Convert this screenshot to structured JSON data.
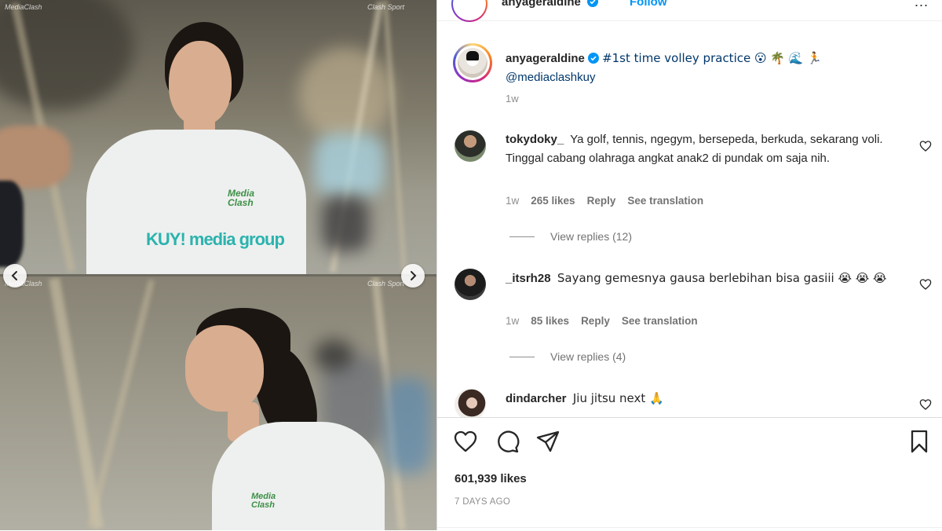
{
  "header": {
    "username": "anyageraldine",
    "follow_label": "Follow",
    "more_label": "..."
  },
  "caption": {
    "username": "anyageraldine",
    "text": "#1st time volley practice 😮 🌴 🌊 🏃",
    "mention": "@mediaclashkuy",
    "time": "1w"
  },
  "comments": [
    {
      "username": "tokydoky_",
      "text": "Ya golf, tennis, ngegym, bersepeda, berkuda, sekarang voli. Tinggal cabang olahraga angkat anak2 di pundak om saja nih.",
      "time": "1w",
      "likes": "265 likes",
      "reply_label": "Reply",
      "translate_label": "See translation",
      "view_replies": "View replies (12)"
    },
    {
      "username": "_itsrh28",
      "text": "Sayang gemesnya gausa berlebihan bisa gasiii 😭 😭 😭",
      "time": "1w",
      "likes": "85 likes",
      "reply_label": "Reply",
      "translate_label": "See translation",
      "view_replies": "View replies (4)"
    },
    {
      "username": "dindarcher",
      "text": "Jiu jitsu next 🙏"
    }
  ],
  "footer": {
    "likes": "601,939 likes",
    "date": "7 DAYS AGO"
  },
  "media": {
    "shirt_brand": "KUY! media group",
    "shirt_logo": "Media Clash",
    "watermark_left": "MediaClash",
    "watermark_right": "Clash Sport"
  },
  "colors": {
    "accent": "#0095f6",
    "link": "#00376b",
    "muted": "#8e8e8e",
    "text": "#262626"
  }
}
